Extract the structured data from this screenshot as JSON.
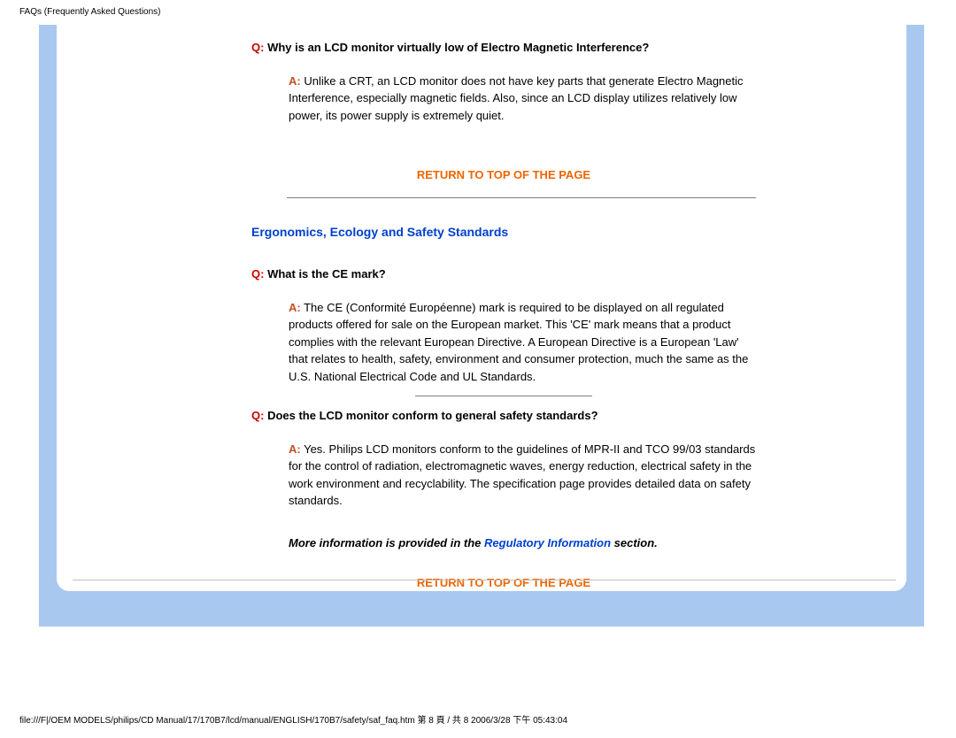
{
  "header": "FAQs (Frequently Asked Questions)",
  "qa1": {
    "q_prefix": "Q:",
    "q_text": " Why is an LCD monitor virtually low of Electro Magnetic Interference?",
    "a_prefix": "A:",
    "a_text": " Unlike a CRT, an LCD monitor does not have key parts that generate Electro Magnetic Interference, especially magnetic fields. Also, since an LCD display utilizes relatively low power, its power supply is extremely quiet."
  },
  "return1": "RETURN TO TOP OF THE PAGE",
  "section_heading": "Ergonomics, Ecology and Safety Standards",
  "qa2": {
    "q_prefix": "Q:",
    "q_text": " What is the CE mark?",
    "a_prefix": "A:",
    "a_text": " The CE (Conformité Européenne) mark is required to be displayed on all regulated products offered for sale on the European market. This 'CE' mark means that a product complies with the relevant European Directive. A European Directive is a European 'Law' that relates to health, safety, environment and consumer protection, much the same as the U.S. National Electrical Code and UL Standards."
  },
  "qa3": {
    "q_prefix": "Q:",
    "q_text": " Does the LCD monitor conform to general safety standards?",
    "a_prefix": "A:",
    "a_text": " Yes. Philips LCD monitors conform to the guidelines of MPR-II and TCO 99/03 standards for the control of radiation, electromagnetic waves, energy reduction, electrical safety in the work environment and recyclability. The specification page provides detailed data on safety standards."
  },
  "more_info_pre": "More information is provided in the ",
  "more_info_link": "Regulatory Information",
  "more_info_post": " section.",
  "return2": "RETURN TO TOP OF THE PAGE",
  "footer": "file:///F|/OEM MODELS/philips/CD Manual/17/170B7/lcd/manual/ENGLISH/170B7/safety/saf_faq.htm 第 8 頁 / 共 8 2006/3/28 下午 05:43:04"
}
